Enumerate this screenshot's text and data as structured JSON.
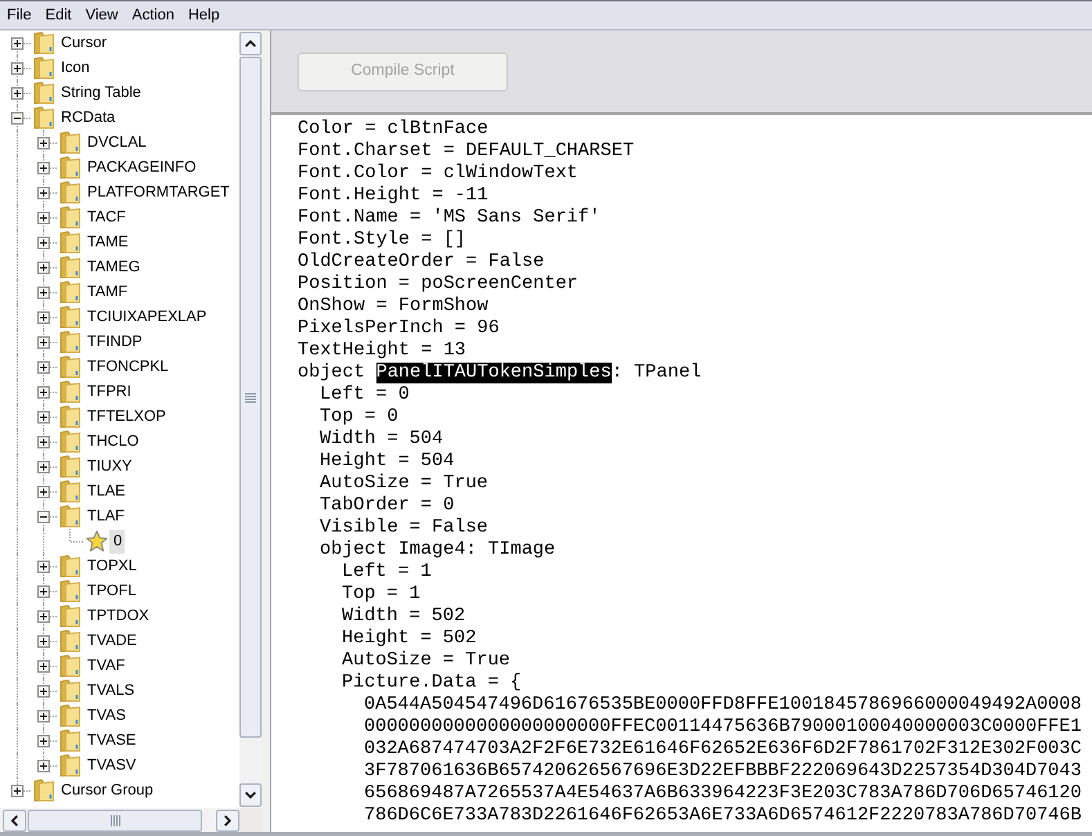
{
  "menu": [
    "File",
    "Edit",
    "View",
    "Action",
    "Help"
  ],
  "tree": {
    "items": [
      {
        "label": "Cursor",
        "kind": "folder",
        "expanded": false,
        "selected": false
      },
      {
        "label": "Icon",
        "kind": "folder",
        "expanded": false,
        "selected": false
      },
      {
        "label": "String Table",
        "kind": "folder",
        "expanded": false,
        "selected": false
      },
      {
        "label": "RCData",
        "kind": "folder",
        "expanded": true,
        "selected": false,
        "children": [
          {
            "label": "DVCLAL",
            "kind": "folder",
            "expanded": false,
            "selected": false
          },
          {
            "label": "PACKAGEINFO",
            "kind": "folder",
            "expanded": false,
            "selected": false
          },
          {
            "label": "PLATFORMTARGET",
            "kind": "folder",
            "expanded": false,
            "selected": false
          },
          {
            "label": "TACF",
            "kind": "folder",
            "expanded": false,
            "selected": false
          },
          {
            "label": "TAME",
            "kind": "folder",
            "expanded": false,
            "selected": false
          },
          {
            "label": "TAMEG",
            "kind": "folder",
            "expanded": false,
            "selected": false
          },
          {
            "label": "TAMF",
            "kind": "folder",
            "expanded": false,
            "selected": false
          },
          {
            "label": "TCIUIXAPEXLAP",
            "kind": "folder",
            "expanded": false,
            "selected": false
          },
          {
            "label": "TFINDP",
            "kind": "folder",
            "expanded": false,
            "selected": false
          },
          {
            "label": "TFONCPKL",
            "kind": "folder",
            "expanded": false,
            "selected": false
          },
          {
            "label": "TFPRI",
            "kind": "folder",
            "expanded": false,
            "selected": false
          },
          {
            "label": "TFTELXOP",
            "kind": "folder",
            "expanded": false,
            "selected": false
          },
          {
            "label": "THCLO",
            "kind": "folder",
            "expanded": false,
            "selected": false
          },
          {
            "label": "TIUXY",
            "kind": "folder",
            "expanded": false,
            "selected": false
          },
          {
            "label": "TLAE",
            "kind": "folder",
            "expanded": false,
            "selected": false
          },
          {
            "label": "TLAF",
            "kind": "folder",
            "expanded": true,
            "selected": false,
            "children": [
              {
                "label": "0",
                "kind": "resource",
                "selected": true
              }
            ]
          },
          {
            "label": "TOPXL",
            "kind": "folder",
            "expanded": false,
            "selected": false
          },
          {
            "label": "TPOFL",
            "kind": "folder",
            "expanded": false,
            "selected": false
          },
          {
            "label": "TPTDOX",
            "kind": "folder",
            "expanded": false,
            "selected": false
          },
          {
            "label": "TVADE",
            "kind": "folder",
            "expanded": false,
            "selected": false
          },
          {
            "label": "TVAF",
            "kind": "folder",
            "expanded": false,
            "selected": false
          },
          {
            "label": "TVALS",
            "kind": "folder",
            "expanded": false,
            "selected": false
          },
          {
            "label": "TVAS",
            "kind": "folder",
            "expanded": false,
            "selected": false
          },
          {
            "label": "TVASE",
            "kind": "folder",
            "expanded": false,
            "selected": false
          },
          {
            "label": "TVASV",
            "kind": "folder",
            "expanded": false,
            "selected": false
          }
        ]
      },
      {
        "label": "Cursor Group",
        "kind": "folder",
        "expanded": false,
        "selected": false
      }
    ]
  },
  "toolbar": {
    "compile_button": {
      "label": "Compile Script",
      "disabled": true
    }
  },
  "editor": {
    "lines": [
      {
        "text": "Color = clBtnFace"
      },
      {
        "text": "Font.Charset = DEFAULT_CHARSET"
      },
      {
        "text": "Font.Color = clWindowText"
      },
      {
        "text": "Font.Height = -11"
      },
      {
        "text": "Font.Name = 'MS Sans Serif'"
      },
      {
        "text": "Font.Style = []"
      },
      {
        "text": "OldCreateOrder = False"
      },
      {
        "text": "Position = poScreenCenter"
      },
      {
        "text": "OnShow = FormShow"
      },
      {
        "text": "PixelsPerInch = 96"
      },
      {
        "text": "TextHeight = 13"
      },
      {
        "segments": [
          {
            "text": "object ",
            "selected": false
          },
          {
            "text": "PanelITAUTokenSimples",
            "selected": true
          },
          {
            "text": ": TPanel",
            "selected": false
          }
        ],
        "children": [
          {
            "text": "Left = 0"
          },
          {
            "text": "Top = 0"
          },
          {
            "text": "Width = 504"
          },
          {
            "text": "Height = 504"
          },
          {
            "text": "AutoSize = True"
          },
          {
            "text": "TabOrder = 0"
          },
          {
            "text": "Visible = False"
          },
          {
            "text": "object Image4: TImage",
            "children": [
              {
                "text": "Left = 1"
              },
              {
                "text": "Top = 1"
              },
              {
                "text": "Width = 502"
              },
              {
                "text": "Height = 502"
              },
              {
                "text": "AutoSize = True"
              },
              {
                "text": "Picture.Data = {",
                "children": [
                  {
                    "text": "0A544A504547496D61676535BE0000FFD8FFE1001845786966000049492A0008"
                  },
                  {
                    "text": "0000000000000000000000FFEC00114475636B79000100040000003C0000FFE1"
                  },
                  {
                    "text": "032A687474703A2F2F6E732E61646F62652E636F6D2F7861702F312E302F003C"
                  },
                  {
                    "text": "3F787061636B657420626567696E3D22EFBBBF222069643D2257354D304D7043"
                  },
                  {
                    "text": "656869487A7265537A4E54637A6B633964223F3E203C783A786D706D65746120"
                  },
                  {
                    "text": "786D6C6E733A783D2261646F62653A6E733A6D6574612F2220783A786D70746B"
                  }
                ]
              }
            ]
          }
        ]
      }
    ]
  }
}
